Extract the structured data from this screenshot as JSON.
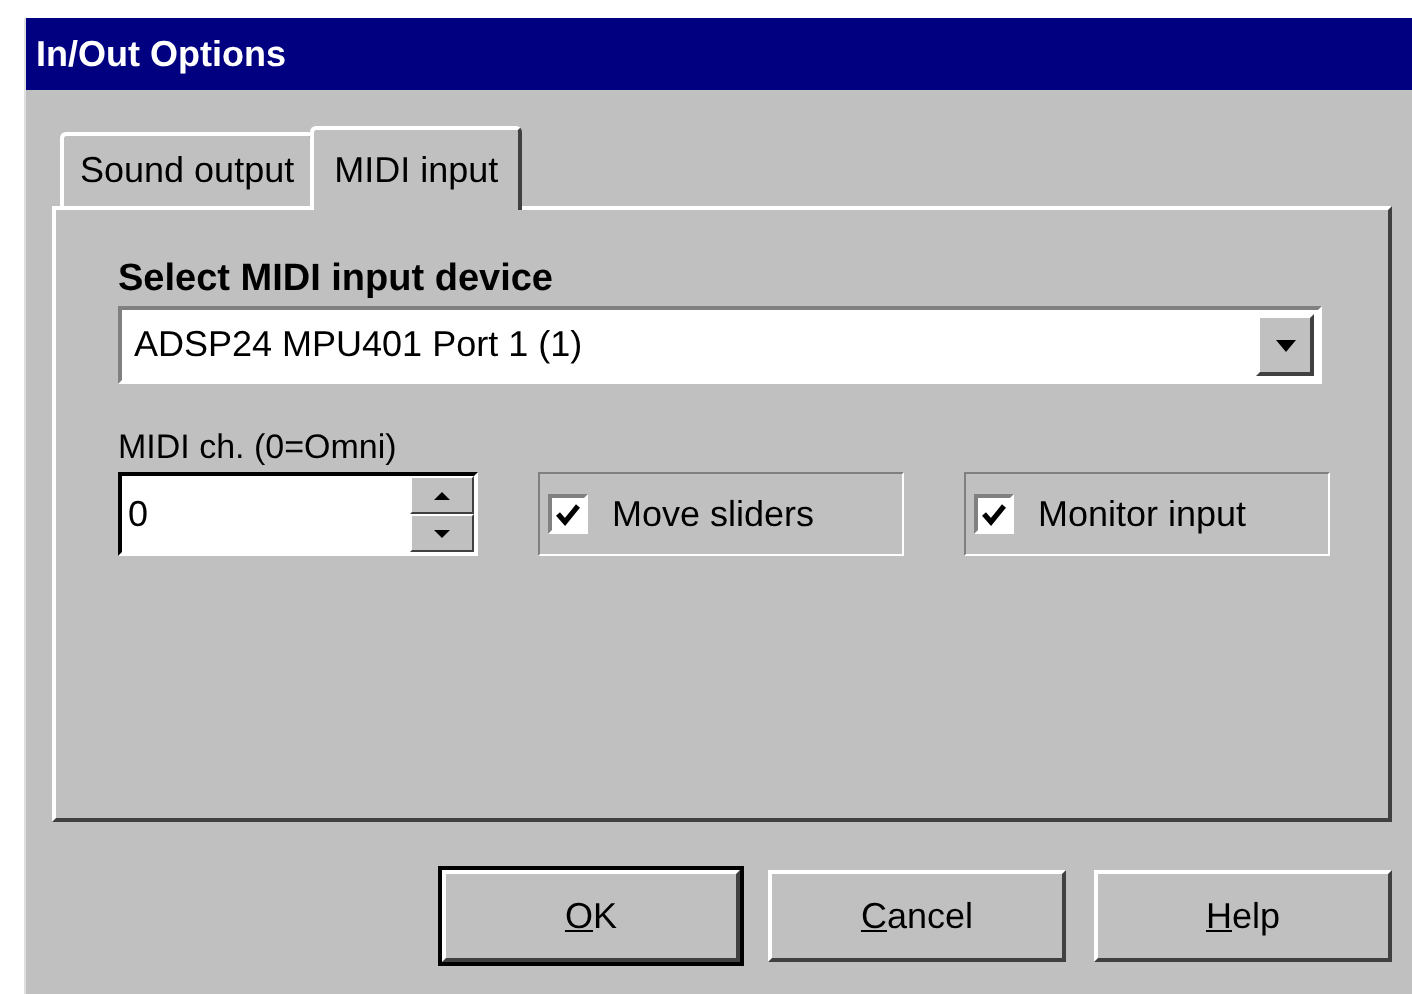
{
  "window": {
    "title": "In/Out Options"
  },
  "tabs": [
    {
      "label": "Sound output",
      "selected": false
    },
    {
      "label": "MIDI input",
      "selected": true
    }
  ],
  "device": {
    "label": "Select MIDI input device",
    "value": "ADSP24 MPU401 Port 1 (1)"
  },
  "channel": {
    "label": "MIDI ch. (0=Omni)",
    "value": "0"
  },
  "options": [
    {
      "label": "Move sliders",
      "checked": true
    },
    {
      "label": "Monitor input",
      "checked": true
    }
  ],
  "buttons": [
    {
      "label": "OK",
      "first_letter_underlined": true,
      "default": true
    },
    {
      "label": "Cancel",
      "first_letter_underlined": true,
      "default": false
    },
    {
      "label": "Help",
      "first_letter_underlined": true,
      "default": false
    }
  ]
}
